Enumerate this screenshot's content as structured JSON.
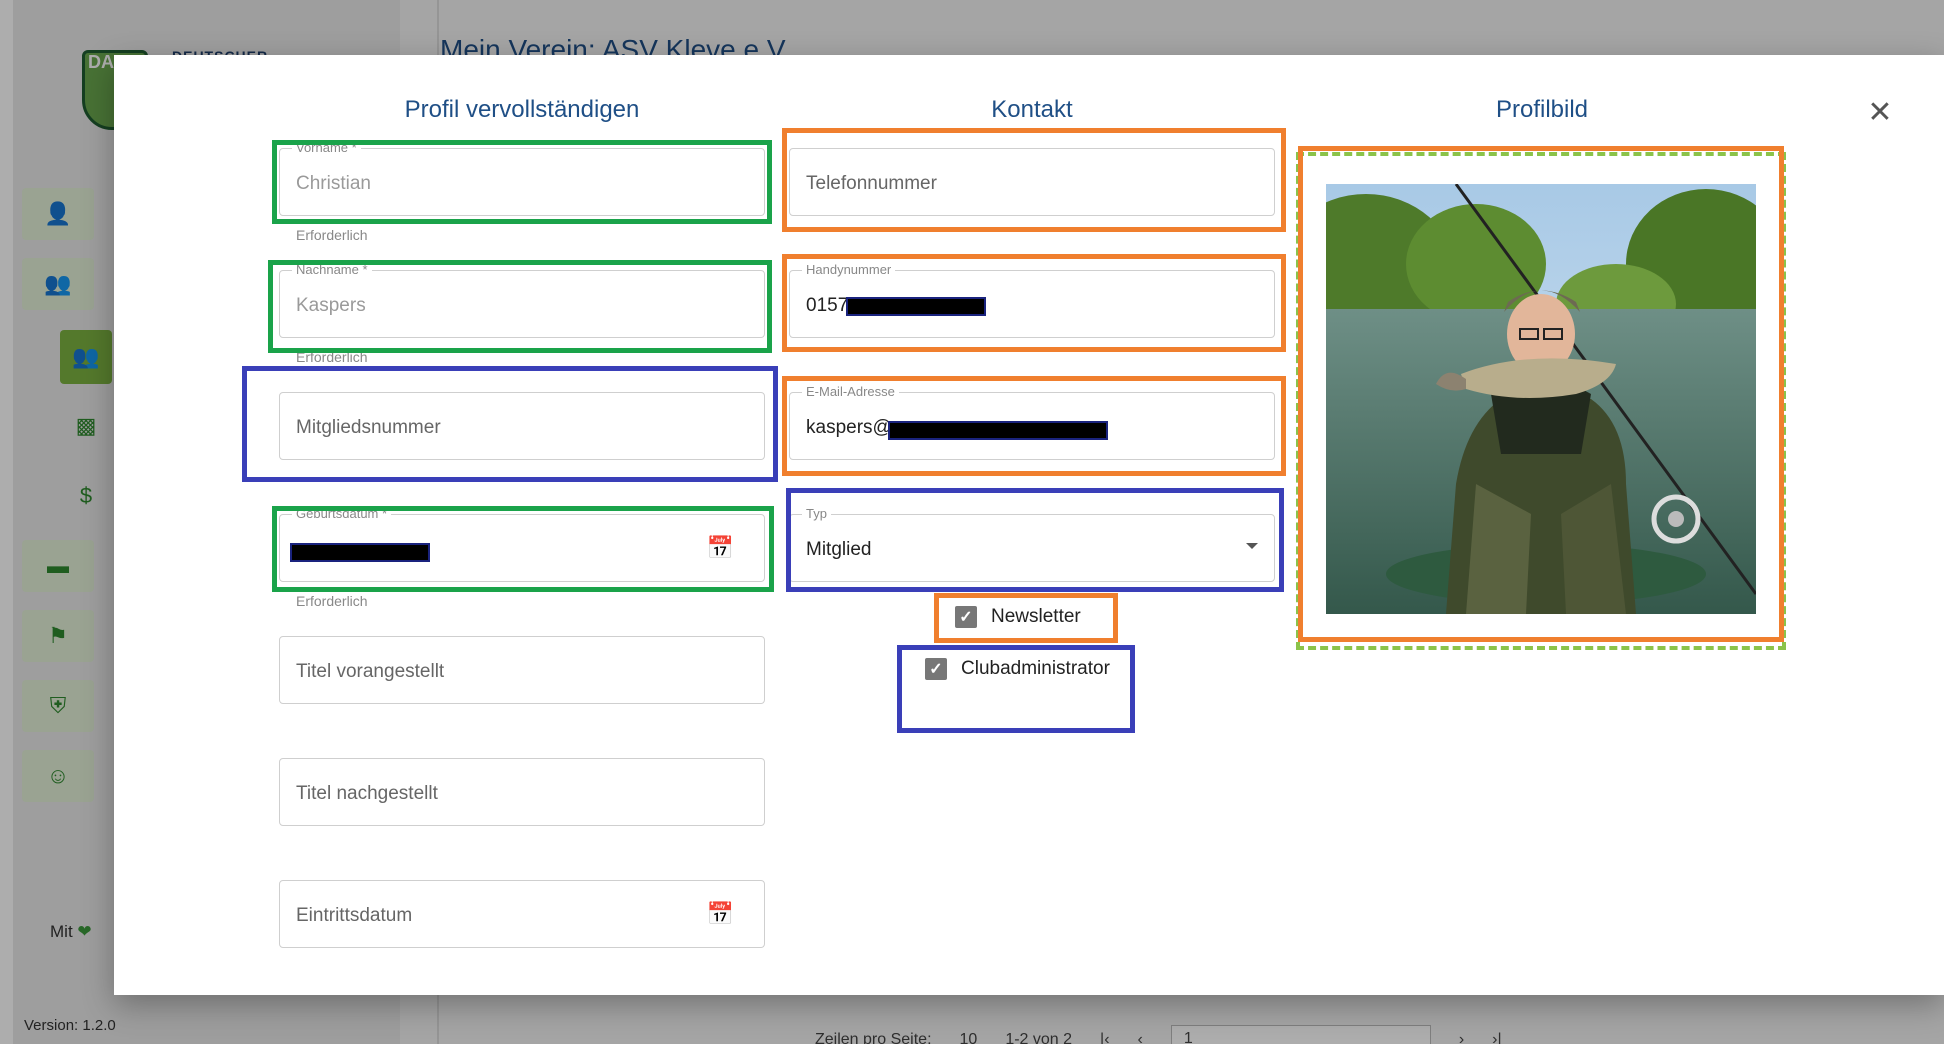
{
  "background": {
    "brand": "DEUTSCHER",
    "logo_text": "DA",
    "page_title": "Mein Verein: ASV Kleve e.V.",
    "footer_made_with": "Mit",
    "version": "Version: 1.2.0",
    "pager": {
      "rows_label": "Zeilen pro Seite:",
      "rows_value": "10",
      "range": "1-2 von 2",
      "page_value": "1"
    }
  },
  "modal": {
    "close_icon": "close-icon",
    "columns": {
      "profile_title": "Profil vervollständigen",
      "contact_title": "Kontakt",
      "picture_title": "Profilbild"
    },
    "profile": {
      "firstname": {
        "label": "Vorname *",
        "value": "Christian",
        "helper": "Erforderlich"
      },
      "lastname": {
        "label": "Nachname *",
        "value": "Kaspers",
        "helper": "Erforderlich"
      },
      "member_number": {
        "placeholder": "Mitgliedsnummer"
      },
      "birthdate": {
        "label": "Geburtsdatum *",
        "helper": "Erforderlich",
        "icon": "calendar-icon"
      },
      "title_before": {
        "placeholder": "Titel vorangestellt"
      },
      "title_after": {
        "placeholder": "Titel nachgestellt"
      },
      "entry_date": {
        "placeholder": "Eintrittsdatum",
        "icon": "calendar-icon"
      }
    },
    "contact": {
      "phone": {
        "placeholder": "Telefonnummer"
      },
      "mobile": {
        "label": "Handynummer",
        "value": "0157"
      },
      "email": {
        "label": "E-Mail-Adresse",
        "value": "kaspers@"
      },
      "type": {
        "label": "Typ",
        "value": "Mitglied"
      },
      "newsletter": {
        "label": "Newsletter",
        "checked": true
      },
      "club_admin": {
        "label": "Clubadministrator",
        "checked": true
      }
    }
  },
  "annotation_colors": {
    "green": "#1aa34a",
    "orange": "#f07f2e",
    "blue": "#3a3fb8",
    "dashed_green": "#8bc34a"
  }
}
